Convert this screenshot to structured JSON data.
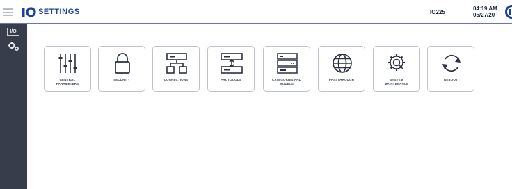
{
  "header": {
    "title": "SETTINGS",
    "logo_text": "IO",
    "device_id": "IO225",
    "time": "04:19 AM",
    "date": "05/27/20"
  },
  "sidebar": {
    "items": [
      {
        "label": "I/O",
        "icon": "io-icon"
      },
      {
        "label": "",
        "icon": "settings-gears-icon"
      }
    ]
  },
  "tiles": [
    {
      "label": "GENERAL\nPARAMETERS",
      "icon": "sliders-icon"
    },
    {
      "label": "SECURITY",
      "icon": "lock-icon"
    },
    {
      "label": "CONNECTIONS",
      "icon": "network-icon"
    },
    {
      "label": "PROTOCOLS",
      "icon": "protocol-icon"
    },
    {
      "label": "CATEGORIES AND\nMODELS",
      "icon": "server-rack-icon"
    },
    {
      "label": "PASSTHROUGH",
      "icon": "globe-icon"
    },
    {
      "label": "SYSTEM\nMAINTENANCE",
      "icon": "gear-search-icon"
    },
    {
      "label": "REBOOT",
      "icon": "reboot-icon"
    }
  ],
  "colors": {
    "brand": "#1d3f9e",
    "header_underline": "#6c6fd2",
    "sidebar": "#373d4a",
    "tile_border": "#bfc3cc",
    "icon": "#2b3042"
  }
}
